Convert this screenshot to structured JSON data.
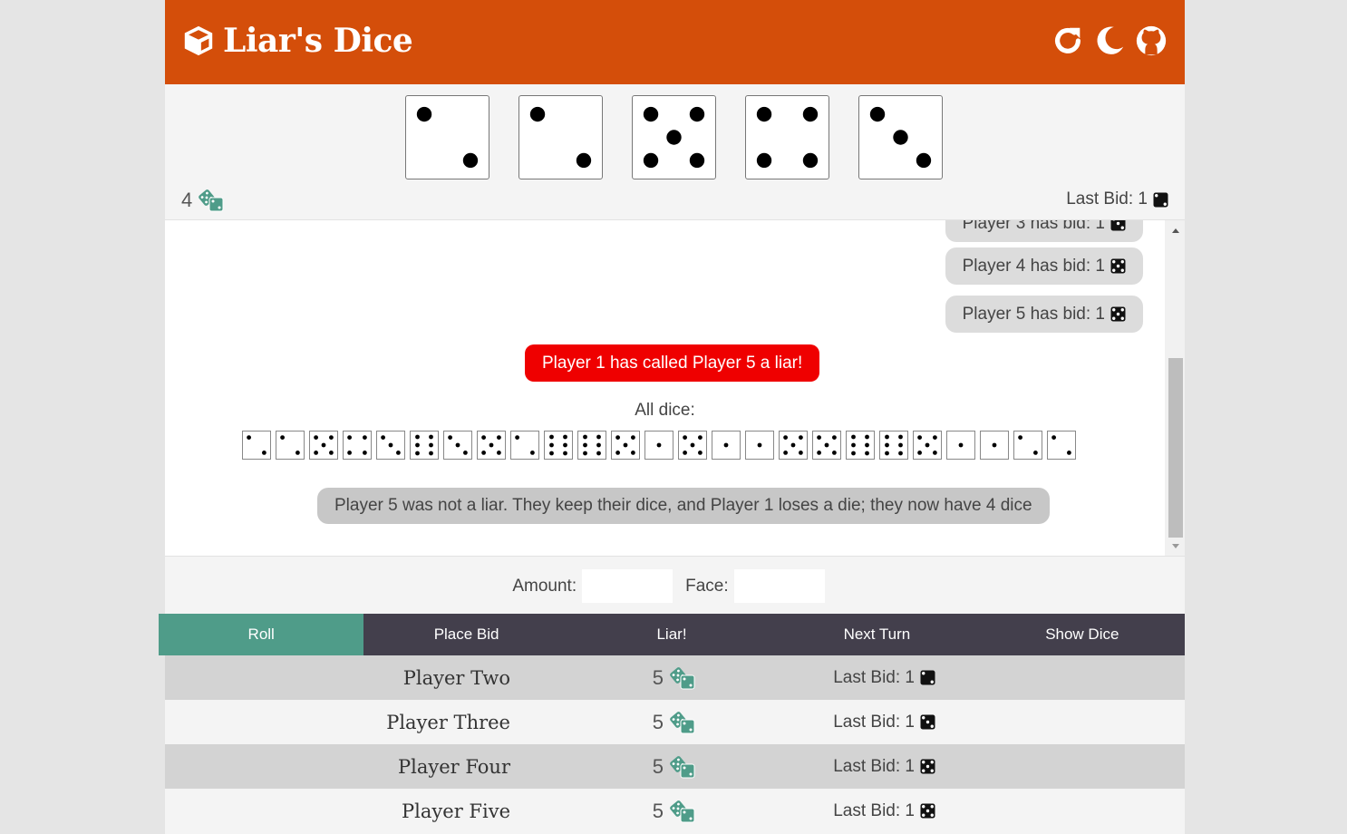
{
  "app": {
    "title": "Liar's Dice"
  },
  "header": {
    "icons": [
      "dice-logo-icon",
      "refresh-icon",
      "moon-icon",
      "github-icon"
    ]
  },
  "colors": {
    "header": "#d44e0a",
    "accent": "#4f9c89",
    "liar": "#ef0000",
    "action_bar": "#433f4c"
  },
  "player": {
    "dice": [
      2,
      2,
      5,
      4,
      3
    ],
    "dice_count": "4",
    "last_bid_label": "Last Bid: 1",
    "last_bid_face": 2
  },
  "chat": {
    "bids": [
      {
        "text": "Player 3 has bid: 1",
        "face": 3
      },
      {
        "text": "Player 4 has bid: 1",
        "face": 5
      },
      {
        "text": "Player 5 has bid: 1",
        "face": 5
      }
    ],
    "liar_call": "Player 1 has called Player 5 a liar!",
    "all_dice_label": "All dice:",
    "all_dice": [
      2,
      2,
      5,
      4,
      3,
      6,
      3,
      5,
      2,
      6,
      6,
      5,
      1,
      5,
      1,
      1,
      5,
      5,
      6,
      6,
      5,
      1,
      1,
      2,
      2
    ],
    "result": "Player 5 was not a liar. They keep their dice, and Player 1 loses a die; they now have 4 dice"
  },
  "bid_form": {
    "amount_label": "Amount:",
    "face_label": "Face:",
    "amount_value": "",
    "face_value": ""
  },
  "actions": [
    {
      "label": "Roll",
      "active": true
    },
    {
      "label": "Place Bid",
      "active": false
    },
    {
      "label": "Liar!",
      "active": false
    },
    {
      "label": "Next Turn",
      "active": false
    },
    {
      "label": "Show Dice",
      "active": false
    }
  ],
  "opponents": [
    {
      "name": "Player Two",
      "dice_count": "5",
      "last_bid_label": "Last Bid: 1",
      "last_bid_face": 2
    },
    {
      "name": "Player Three",
      "dice_count": "5",
      "last_bid_label": "Last Bid: 1",
      "last_bid_face": 3
    },
    {
      "name": "Player Four",
      "dice_count": "5",
      "last_bid_label": "Last Bid: 1",
      "last_bid_face": 5
    },
    {
      "name": "Player Five",
      "dice_count": "5",
      "last_bid_label": "Last Bid: 1",
      "last_bid_face": 5
    }
  ]
}
